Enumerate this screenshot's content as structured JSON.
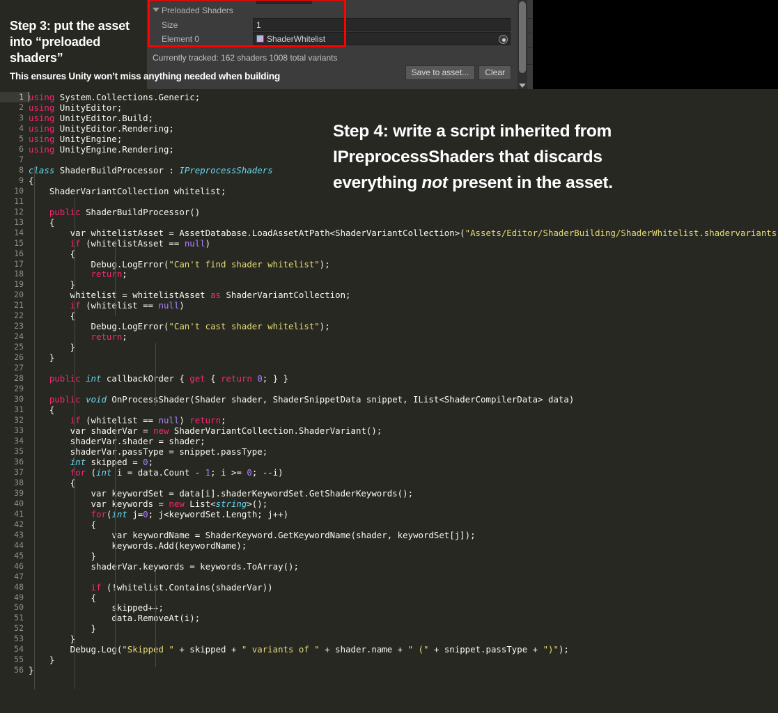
{
  "annotations": {
    "step3_title": "Step 3:  put the asset into “preloaded shaders”",
    "step3_caption": "This ensures Unity won’t miss anything needed when building",
    "step4_line1": "Step 4: write a script inherited from",
    "step4_line2": "IPreprocessShaders that discards",
    "step4_line3_a": "everything ",
    "step4_line3_em": "not",
    "step4_line3_b": " present in the asset."
  },
  "unity_panel": {
    "foldout_label": "Preloaded Shaders",
    "size_label": "Size",
    "size_value": "1",
    "element_label": "Element 0",
    "element_value": "ShaderWhitelist",
    "tracked_status": "Currently tracked: 162 shaders 1008 total variants",
    "save_button": "Save to asset...",
    "clear_button": "Clear",
    "highlight_color": "#fe0000",
    "panel_bg": "#3c3c3c"
  },
  "editor": {
    "background": "#272822",
    "first_line_number": 1,
    "total_lines": 56,
    "active_line": 1,
    "line_numbers": [
      1,
      2,
      3,
      4,
      5,
      6,
      7,
      8,
      9,
      10,
      11,
      12,
      13,
      14,
      15,
      16,
      17,
      18,
      19,
      20,
      21,
      22,
      23,
      24,
      25,
      26,
      27,
      28,
      29,
      30,
      31,
      32,
      33,
      34,
      35,
      36,
      37,
      38,
      39,
      40,
      41,
      42,
      43,
      44,
      45,
      46,
      47,
      48,
      49,
      50,
      51,
      52,
      53,
      54,
      55,
      56
    ],
    "lines": [
      [
        {
          "c": "k",
          "v": "using"
        },
        {
          "c": "p",
          "v": " System.Collections.Generic;"
        }
      ],
      [
        {
          "c": "k",
          "v": "using"
        },
        {
          "c": "p",
          "v": " UnityEditor;"
        }
      ],
      [
        {
          "c": "k",
          "v": "using"
        },
        {
          "c": "p",
          "v": " UnityEditor.Build;"
        }
      ],
      [
        {
          "c": "k",
          "v": "using"
        },
        {
          "c": "p",
          "v": " UnityEditor.Rendering;"
        }
      ],
      [
        {
          "c": "k",
          "v": "using"
        },
        {
          "c": "p",
          "v": " UnityEngine;"
        }
      ],
      [
        {
          "c": "k",
          "v": "using"
        },
        {
          "c": "p",
          "v": " UnityEngine.Rendering;"
        }
      ],
      [],
      [
        {
          "c": "t",
          "v": "class"
        },
        {
          "c": "p",
          "v": " ShaderBuildProcessor : "
        },
        {
          "c": "t",
          "v": "IPreprocessShaders"
        }
      ],
      [
        {
          "c": "p",
          "v": "{"
        }
      ],
      [
        {
          "c": "p",
          "v": "    ShaderVariantCollection whitelist;"
        }
      ],
      [],
      [
        {
          "c": "p",
          "v": "    "
        },
        {
          "c": "k",
          "v": "public"
        },
        {
          "c": "p",
          "v": " ShaderBuildProcessor()"
        }
      ],
      [
        {
          "c": "p",
          "v": "    {"
        }
      ],
      [
        {
          "c": "p",
          "v": "        var whitelistAsset = AssetDatabase.LoadAssetAtPath<ShaderVariantCollection>("
        },
        {
          "c": "s",
          "v": "\"Assets/Editor/ShaderBuilding/ShaderWhitelist.shadervariants\""
        },
        {
          "c": "p",
          "v": ");"
        }
      ],
      [
        {
          "c": "p",
          "v": "        "
        },
        {
          "c": "k",
          "v": "if"
        },
        {
          "c": "p",
          "v": " (whitelistAsset == "
        },
        {
          "c": "n",
          "v": "null"
        },
        {
          "c": "p",
          "v": ")"
        }
      ],
      [
        {
          "c": "p",
          "v": "        {"
        }
      ],
      [
        {
          "c": "p",
          "v": "            Debug.LogError("
        },
        {
          "c": "s",
          "v": "\"Can't find shader whitelist\""
        },
        {
          "c": "p",
          "v": ");"
        }
      ],
      [
        {
          "c": "p",
          "v": "            "
        },
        {
          "c": "k",
          "v": "return"
        },
        {
          "c": "p",
          "v": ";"
        }
      ],
      [
        {
          "c": "p",
          "v": "        }"
        }
      ],
      [
        {
          "c": "p",
          "v": "        whitelist = whitelistAsset "
        },
        {
          "c": "k",
          "v": "as"
        },
        {
          "c": "p",
          "v": " ShaderVariantCollection;"
        }
      ],
      [
        {
          "c": "p",
          "v": "        "
        },
        {
          "c": "k",
          "v": "if"
        },
        {
          "c": "p",
          "v": " (whitelist == "
        },
        {
          "c": "n",
          "v": "null"
        },
        {
          "c": "p",
          "v": ")"
        }
      ],
      [
        {
          "c": "p",
          "v": "        {"
        }
      ],
      [
        {
          "c": "p",
          "v": "            Debug.LogError("
        },
        {
          "c": "s",
          "v": "\"Can't cast shader whitelist\""
        },
        {
          "c": "p",
          "v": ");"
        }
      ],
      [
        {
          "c": "p",
          "v": "            "
        },
        {
          "c": "k",
          "v": "return"
        },
        {
          "c": "p",
          "v": ";"
        }
      ],
      [
        {
          "c": "p",
          "v": "        }"
        }
      ],
      [
        {
          "c": "p",
          "v": "    }"
        }
      ],
      [],
      [
        {
          "c": "p",
          "v": "    "
        },
        {
          "c": "k",
          "v": "public"
        },
        {
          "c": "p",
          "v": " "
        },
        {
          "c": "t",
          "v": "int"
        },
        {
          "c": "p",
          "v": " callbackOrder { "
        },
        {
          "c": "k",
          "v": "get"
        },
        {
          "c": "p",
          "v": " { "
        },
        {
          "c": "k",
          "v": "return"
        },
        {
          "c": "p",
          "v": " "
        },
        {
          "c": "n",
          "v": "0"
        },
        {
          "c": "p",
          "v": "; } }"
        }
      ],
      [],
      [
        {
          "c": "p",
          "v": "    "
        },
        {
          "c": "k",
          "v": "public"
        },
        {
          "c": "p",
          "v": " "
        },
        {
          "c": "t",
          "v": "void"
        },
        {
          "c": "p",
          "v": " OnProcessShader(Shader shader, ShaderSnippetData snippet, IList<ShaderCompilerData> data)"
        }
      ],
      [
        {
          "c": "p",
          "v": "    {"
        }
      ],
      [
        {
          "c": "p",
          "v": "        "
        },
        {
          "c": "k",
          "v": "if"
        },
        {
          "c": "p",
          "v": " (whitelist == "
        },
        {
          "c": "n",
          "v": "null"
        },
        {
          "c": "p",
          "v": ") "
        },
        {
          "c": "k",
          "v": "return"
        },
        {
          "c": "p",
          "v": ";"
        }
      ],
      [
        {
          "c": "p",
          "v": "        var shaderVar = "
        },
        {
          "c": "k",
          "v": "new"
        },
        {
          "c": "p",
          "v": " ShaderVariantCollection.ShaderVariant();"
        }
      ],
      [
        {
          "c": "p",
          "v": "        shaderVar.shader = shader;"
        }
      ],
      [
        {
          "c": "p",
          "v": "        shaderVar.passType = snippet.passType;"
        }
      ],
      [
        {
          "c": "p",
          "v": "        "
        },
        {
          "c": "t",
          "v": "int"
        },
        {
          "c": "p",
          "v": " skipped = "
        },
        {
          "c": "n",
          "v": "0"
        },
        {
          "c": "p",
          "v": ";"
        }
      ],
      [
        {
          "c": "p",
          "v": "        "
        },
        {
          "c": "k",
          "v": "for"
        },
        {
          "c": "p",
          "v": " ("
        },
        {
          "c": "t",
          "v": "int"
        },
        {
          "c": "p",
          "v": " i = data.Count - "
        },
        {
          "c": "n",
          "v": "1"
        },
        {
          "c": "p",
          "v": "; i >= "
        },
        {
          "c": "n",
          "v": "0"
        },
        {
          "c": "p",
          "v": "; --i)"
        }
      ],
      [
        {
          "c": "p",
          "v": "        {"
        }
      ],
      [
        {
          "c": "p",
          "v": "            var keywordSet = data[i].shaderKeywordSet.GetShaderKeywords();"
        }
      ],
      [
        {
          "c": "p",
          "v": "            var keywords = "
        },
        {
          "c": "k",
          "v": "new"
        },
        {
          "c": "p",
          "v": " List<"
        },
        {
          "c": "t",
          "v": "string"
        },
        {
          "c": "p",
          "v": ">();"
        }
      ],
      [
        {
          "c": "p",
          "v": "            "
        },
        {
          "c": "k",
          "v": "for"
        },
        {
          "c": "p",
          "v": "("
        },
        {
          "c": "t",
          "v": "int"
        },
        {
          "c": "p",
          "v": " j="
        },
        {
          "c": "n",
          "v": "0"
        },
        {
          "c": "p",
          "v": "; j<keywordSet.Length; j++)"
        }
      ],
      [
        {
          "c": "p",
          "v": "            {"
        }
      ],
      [
        {
          "c": "p",
          "v": "                var keywordName = ShaderKeyword.GetKeywordName(shader, keywordSet[j]);"
        }
      ],
      [
        {
          "c": "p",
          "v": "                keywords.Add(keywordName);"
        }
      ],
      [
        {
          "c": "p",
          "v": "            }"
        }
      ],
      [
        {
          "c": "p",
          "v": "            shaderVar.keywords = keywords.ToArray();"
        }
      ],
      [],
      [
        {
          "c": "p",
          "v": "            "
        },
        {
          "c": "k",
          "v": "if"
        },
        {
          "c": "p",
          "v": " (!whitelist.Contains(shaderVar))"
        }
      ],
      [
        {
          "c": "p",
          "v": "            {"
        }
      ],
      [
        {
          "c": "p",
          "v": "                skipped++;"
        }
      ],
      [
        {
          "c": "p",
          "v": "                data.RemoveAt(i);"
        }
      ],
      [
        {
          "c": "p",
          "v": "            }"
        }
      ],
      [
        {
          "c": "p",
          "v": "        }"
        }
      ],
      [
        {
          "c": "p",
          "v": "        Debug.Log("
        },
        {
          "c": "s",
          "v": "\"Skipped \""
        },
        {
          "c": "p",
          "v": " + skipped + "
        },
        {
          "c": "s",
          "v": "\" variants of \""
        },
        {
          "c": "p",
          "v": " + shader.name + "
        },
        {
          "c": "s",
          "v": "\" (\""
        },
        {
          "c": "p",
          "v": " + snippet.passType + "
        },
        {
          "c": "s",
          "v": "\")\""
        },
        {
          "c": "p",
          "v": ");"
        }
      ],
      [
        {
          "c": "p",
          "v": "    }"
        }
      ],
      [
        {
          "c": "p",
          "v": "}"
        }
      ]
    ],
    "colors": {
      "keyword": "#f92672",
      "type": "#66d9ef",
      "string": "#e6db74",
      "number": "#ae81ff",
      "plain": "#f8f8f2",
      "line_number": "#8f908a",
      "active_line_number_bg": "#3a3b34"
    }
  }
}
